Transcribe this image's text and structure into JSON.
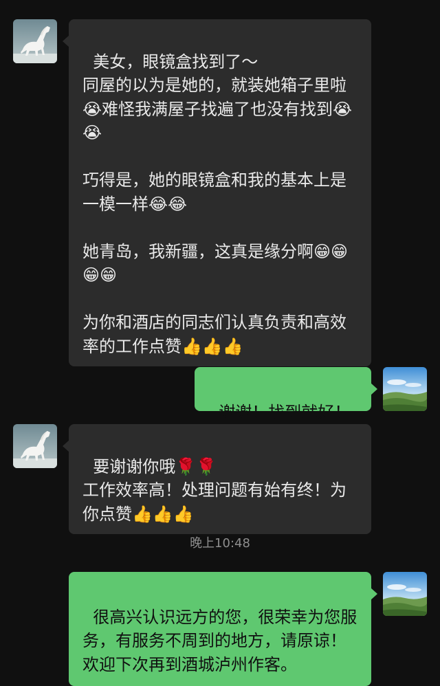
{
  "messages": [
    {
      "side": "incoming",
      "text": "美女，眼镜盒找到了～\n同屋的以为是她的，就装她箱子里啦😭难怪我满屋子找遍了也没有找到😭😭\n\n巧得是，她的眼镜盒和我的基本上是一模一样😂😂\n\n她青岛，我新疆，这真是缘分啊😁😁😁😁\n\n为你和酒店的同志们认真负责和高效率的工作点赞👍👍👍"
    },
    {
      "side": "outgoing",
      "text": "谢谢！找到就好！"
    },
    {
      "side": "incoming",
      "text": "要谢谢你哦🌹🌹\n工作效率高！处理问题有始有终！为你点赞👍👍👍"
    },
    {
      "side": "outgoing",
      "text": "很高兴认识远方的您，很荣幸为您服务，有服务不周到的地方，请原谅！欢迎下次再到酒城泸州作客。"
    }
  ],
  "timestamp": "晚上10:48",
  "colors": {
    "background": "#101010",
    "incoming_bubble": "#2c2c2c",
    "outgoing_bubble": "#5fc870",
    "timestamp_text": "#8e8e8e"
  },
  "avatars": {
    "contact": "white-horse-avatar-icon",
    "self": "landscape-avatar-icon"
  }
}
